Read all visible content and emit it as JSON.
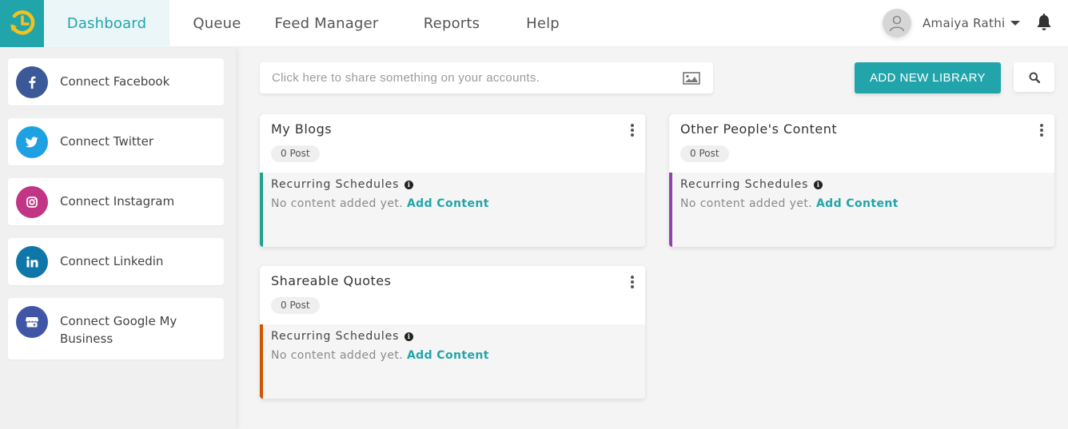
{
  "colors": {
    "brand": "#21a5ab",
    "logo_accent": "#f5c21b",
    "facebook": "#3b5998",
    "twitter": "#1da1e2",
    "instagram": "#c13584",
    "linkedin": "#0e76a8",
    "google_business": "#3f55a5",
    "card_blogs": "#1fa38c",
    "card_others": "#8e44ad",
    "card_quotes": "#d35400"
  },
  "header": {
    "logo_icon": "clock-refresh-icon",
    "nav": [
      {
        "label": "Dashboard",
        "active": true
      },
      {
        "label": "Queue",
        "active": false
      },
      {
        "label": "Feed Manager",
        "active": false
      },
      {
        "label": "Reports",
        "active": false
      },
      {
        "label": "Help",
        "active": false
      }
    ],
    "user_name": "Amaiya Rathi",
    "notification_icon": "bell-icon"
  },
  "sidebar": {
    "items": [
      {
        "label": "Connect Facebook",
        "icon": "facebook-icon"
      },
      {
        "label": "Connect Twitter",
        "icon": "twitter-icon"
      },
      {
        "label": "Connect Instagram",
        "icon": "instagram-icon"
      },
      {
        "label": "Connect Linkedin",
        "icon": "linkedin-icon"
      },
      {
        "label": "Connect Google My Business",
        "icon": "storefront-icon"
      }
    ]
  },
  "main": {
    "share_placeholder": "Click here to share something on your accounts.",
    "add_library_label": "ADD NEW LIBRARY",
    "libraries": [
      {
        "title": "My Blogs",
        "post_count": "0 Post",
        "schedules_label": "Recurring Schedules",
        "empty_text": "No content added yet.",
        "add_content_label": "Add Content"
      },
      {
        "title": "Other People's Content",
        "post_count": "0 Post",
        "schedules_label": "Recurring Schedules",
        "empty_text": "No content added yet.",
        "add_content_label": "Add Content"
      },
      {
        "title": "Shareable Quotes",
        "post_count": "0 Post",
        "schedules_label": "Recurring Schedules",
        "empty_text": "No content added yet.",
        "add_content_label": "Add Content"
      }
    ]
  }
}
